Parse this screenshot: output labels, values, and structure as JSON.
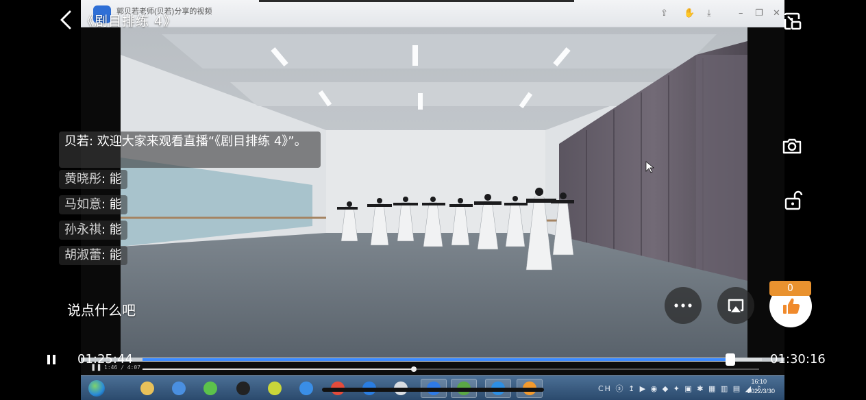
{
  "player": {
    "title": "《剧目排练 4》",
    "current_time": "01:25:44",
    "total_time": "01:30:16",
    "progress_fraction": 0.949,
    "comment_placeholder": "说点什么吧",
    "like_count": "0",
    "accent_color": "#3d8bff",
    "like_badge_color": "#e9922f"
  },
  "chat": {
    "welcome": {
      "sender": "贝若",
      "text": "欢迎大家来观看直播“《剧目排练 4》”。"
    },
    "messages": [
      {
        "sender": "黄晓彤",
        "text": "能"
      },
      {
        "sender": "马如意",
        "text": "能"
      },
      {
        "sender": "孙永祺",
        "text": "能"
      },
      {
        "sender": "胡淑蕾",
        "text": "能"
      }
    ]
  },
  "inner_window": {
    "title": "郭贝若老师(贝若)分享的视频",
    "video_time": "1:46 / 4:07",
    "video_progress_fraction": 0.44
  },
  "taskbar": {
    "apps": [
      "start-orb",
      "explorer",
      "feishu",
      "wechat",
      "qq",
      "app-yellow",
      "baidu-netdisk",
      "chrome",
      "app-circle",
      "media",
      "dingtalk",
      "media-player",
      "ie",
      "app-orange"
    ],
    "clock_time": "16:10",
    "clock_date": "2022/3/30",
    "tray_text": "CH"
  },
  "icons": {
    "back": "chevron-left-icon",
    "pip": "picture-in-picture-icon",
    "camera": "camera-icon",
    "lock": "unlock-icon",
    "more": "ellipsis-icon",
    "cast": "screen-cast-icon",
    "like": "thumbs-up-icon",
    "pause": "pause-icon"
  }
}
